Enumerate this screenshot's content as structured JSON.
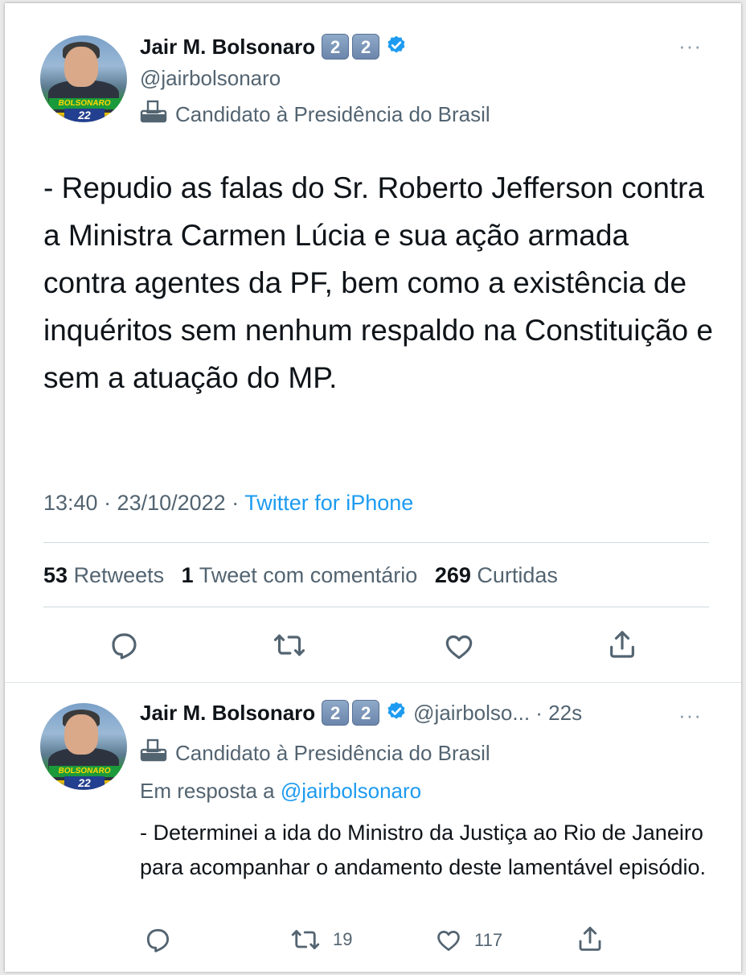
{
  "main_tweet": {
    "author_name": "Jair M. Bolsonaro",
    "badge_digits": [
      "2",
      "2"
    ],
    "handle": "@jairbolsonaro",
    "affiliation": "Candidato à Presidência do Brasil",
    "more_label": "···",
    "text": "- Repudio as falas do Sr. Roberto Jefferson contra a Ministra Carmen Lúcia e sua ação armada contra agentes da PF, bem como a existência de inquéritos sem nenhum respaldo na Constituição e sem a atuação do MP.",
    "time_date": "13:40 · 23/10/2022 · ",
    "source": "Twitter for iPhone",
    "stats": {
      "retweets_count": "53",
      "retweets_label": "Retweets",
      "quotes_count": "1",
      "quotes_label": "Tweet com comentário",
      "likes_count": "269",
      "likes_label": "Curtidas"
    },
    "avatar": {
      "band_text": "BOLSONARO",
      "number_text": "22"
    }
  },
  "reply_tweet": {
    "author_name": "Jair M. Bolsonaro",
    "badge_digits": [
      "2",
      "2"
    ],
    "handle_time": "@jairbolso... · 22s",
    "affiliation": "Candidato à Presidência do Brasil",
    "more_label": "···",
    "reply_prefix": "Em resposta a ",
    "reply_mention": "@jairbolsonaro",
    "text": "- Determinei a ida do Ministro da Justiça ao Rio de Janeiro para acompanhar o andamento deste lamentável episódio.",
    "retweet_count": "19",
    "like_count": "117",
    "avatar": {
      "band_text": "BOLSONARO",
      "number_text": "22"
    }
  },
  "icons": {
    "reply": "reply-icon",
    "retweet": "retweet-icon",
    "like": "heart-icon",
    "share": "share-icon",
    "verified": "verified-badge-icon",
    "affiliation": "ballot-box-icon",
    "more": "more-icon"
  },
  "colors": {
    "link": "#1d9bf0",
    "secondary_text": "#536471",
    "primary_text": "#0f1419",
    "verified": "#1d9bf0"
  }
}
